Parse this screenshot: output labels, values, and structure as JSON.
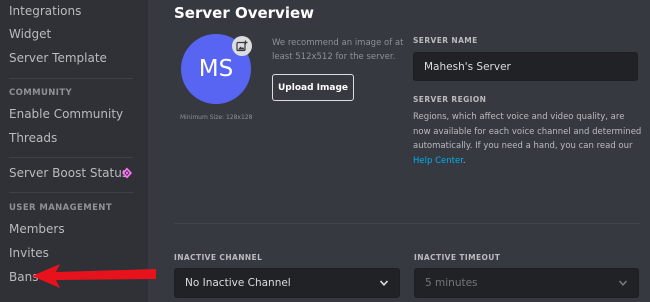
{
  "sidebar": {
    "items_top": [
      {
        "label": "Integrations"
      },
      {
        "label": "Widget"
      },
      {
        "label": "Server Template"
      }
    ],
    "community_header": "COMMUNITY",
    "community_items": [
      {
        "label": "Enable Community"
      },
      {
        "label": "Threads"
      }
    ],
    "boost_label": "Server Boost Status",
    "user_management_header": "USER MANAGEMENT",
    "user_management_items": [
      {
        "label": "Members"
      },
      {
        "label": "Invites"
      },
      {
        "label": "Bans"
      }
    ]
  },
  "main": {
    "title": "Server Overview",
    "avatar_initials": "MS",
    "min_size": "Minimum Size: 128x128",
    "recommend_text": "We recommend an image of at least 512x512 for the server.",
    "upload_button": "Upload Image",
    "server_name_label": "SERVER NAME",
    "server_name_value": "Mahesh's Server",
    "server_region_label": "SERVER REGION",
    "server_region_text": "Regions, which affect voice and video quality, are now available for each voice channel and determined automatically. If you need a hand, you can read our",
    "help_center_link": "Help Center",
    "help_center_suffix": ".",
    "inactive_channel_label": "INACTIVE CHANNEL",
    "inactive_channel_value": "No Inactive Channel",
    "inactive_timeout_label": "INACTIVE TIMEOUT",
    "inactive_timeout_value": "5 minutes"
  },
  "colors": {
    "sidebar_bg": "#2f3136",
    "main_bg": "#36393f",
    "input_bg": "#202225",
    "avatar": "#5865f2",
    "link": "#00aff4",
    "boost": "#ff73fa",
    "arrow": "#e8121c"
  },
  "icons": {
    "boost": "boost-gem-icon",
    "avatar_edit": "image-add-icon",
    "dropdown": "chevron-down-icon"
  }
}
